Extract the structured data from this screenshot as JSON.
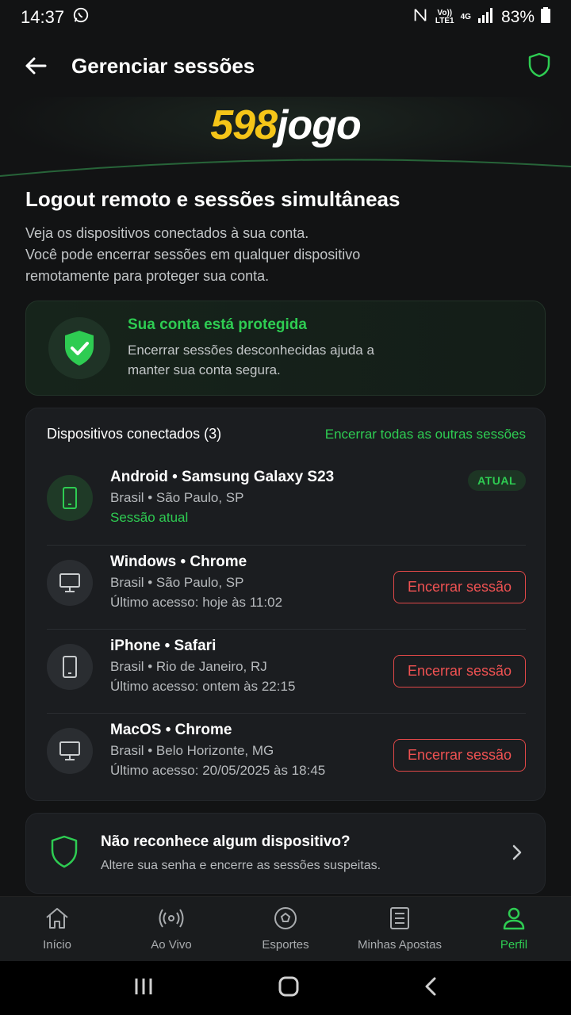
{
  "status_bar": {
    "time": "14:37",
    "volte": "Vo))",
    "lte": "LTE1",
    "network": "4G",
    "battery": "83%"
  },
  "header": {
    "title": "Gerenciar sessões"
  },
  "logo": {
    "number": "598",
    "word": "jogo"
  },
  "intro": {
    "title": "Logout remoto e sessões simultâneas",
    "line1": "Veja os dispositivos conectados à sua conta.",
    "line2": "Você pode encerrar sessões em qualquer dispositivo",
    "line3": "remotamente para proteger sua conta."
  },
  "protection": {
    "title": "Sua conta está protegida",
    "description": "Encerrar sessões desconhecidas ajuda a manter sua conta segura."
  },
  "devices": {
    "title": "Dispositivos conectados (3)",
    "end_all_label": "Encerrar todas as outras sessões",
    "items": [
      {
        "name": "Android • Samsung Galaxy S23",
        "location": "Brasil • São Paulo, SP",
        "status": "Sessão atual",
        "badge": "ATUAL",
        "icon": "smartphone-icon"
      },
      {
        "name": "Windows • Chrome",
        "location": "Brasil • São Paulo, SP",
        "last_access": "Último acesso: hoje às 11:02",
        "action": "Encerrar sessão",
        "icon": "desktop-icon"
      },
      {
        "name": "iPhone • Safari",
        "location": "Brasil • Rio de Janeiro, RJ",
        "last_access": "Último acesso: ontem às 22:15",
        "action": "Encerrar sessão",
        "icon": "smartphone-icon"
      },
      {
        "name": "MacOS • Chrome",
        "location": "Brasil • Belo Horizonte, MG",
        "last_access": "Último acesso: 20/05/2025 às 18:45",
        "action": "Encerrar sessão",
        "icon": "desktop-icon"
      }
    ]
  },
  "help": {
    "title": "Não reconhece algum dispositivo?",
    "description": "Altere sua senha e encerre as sessões suspeitas."
  },
  "bottom_nav": {
    "items": [
      {
        "label": "Início",
        "icon": "home-icon"
      },
      {
        "label": "Ao Vivo",
        "icon": "live-icon"
      },
      {
        "label": "Esportes",
        "icon": "ball-icon"
      },
      {
        "label": "Minhas Apostas",
        "icon": "bets-icon"
      },
      {
        "label": "Perfil",
        "icon": "profile-icon"
      }
    ],
    "active": "Perfil"
  },
  "colors": {
    "background": "#121314",
    "accent_green": "#2ecc52",
    "danger_red": "#f05252",
    "logo_yellow": "#f5c518"
  }
}
